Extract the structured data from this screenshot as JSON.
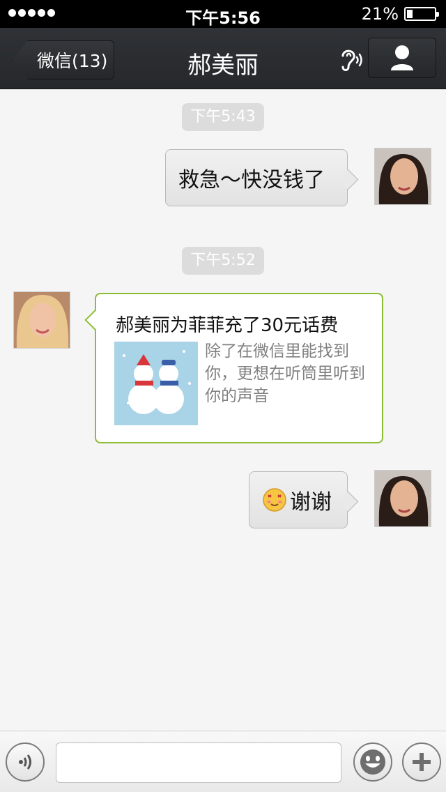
{
  "status_bar": {
    "time": "下午5:56",
    "battery_percent": "21%",
    "battery_level": 0.21
  },
  "nav": {
    "back_label": "微信(13)",
    "title": "郝美丽"
  },
  "messages": [
    {
      "type": "timestamp",
      "text": "下午5:43"
    },
    {
      "type": "outgoing",
      "text": "救急～快没钱了"
    },
    {
      "type": "timestamp",
      "text": "下午5:52"
    },
    {
      "type": "incoming_card",
      "title": "郝美丽为菲菲充了30元话费",
      "body": "除了在微信里能找到你，更想在听筒里听到你的声音"
    },
    {
      "type": "outgoing",
      "text": "谢谢"
    }
  ],
  "input": {
    "value": "",
    "placeholder": ""
  },
  "colors": {
    "card_border": "#8dbd35",
    "navbar": "#2b2e31"
  }
}
